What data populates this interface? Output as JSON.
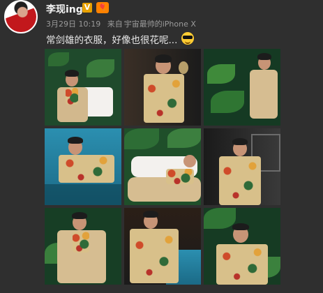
{
  "post": {
    "author": "李现ing",
    "verified_badge": "V",
    "vip_badge": "🎈",
    "date": "3月29日 10:19",
    "source_prefix": "来自",
    "source": "宇宙最帅的iPhone X",
    "text": "常剑雄的衣服，好像也很花呢..."
  },
  "emoji": "sunglasses-emoji",
  "photos": [
    {
      "id": "photo-1",
      "scene": "white sofa, plants, beige suit"
    },
    {
      "id": "photo-2",
      "scene": "indoor, floral shirt, lamp"
    },
    {
      "id": "photo-3",
      "scene": "plants, beige outfit"
    },
    {
      "id": "photo-4",
      "scene": "pool, floral shirt"
    },
    {
      "id": "photo-5",
      "scene": "lying on sofa"
    },
    {
      "id": "photo-6",
      "scene": "modern interior, floral shirt"
    },
    {
      "id": "photo-7",
      "scene": "plants, beige suit"
    },
    {
      "id": "photo-8",
      "scene": "poolside night, floral shirt"
    },
    {
      "id": "photo-9",
      "scene": "tropical plants, hand near face"
    }
  ],
  "colors": {
    "background": "#2f2f2f",
    "text": "#eaeaea",
    "meta": "#9b9b9b",
    "verified": "#e8a100",
    "vip": "#ff8200"
  }
}
